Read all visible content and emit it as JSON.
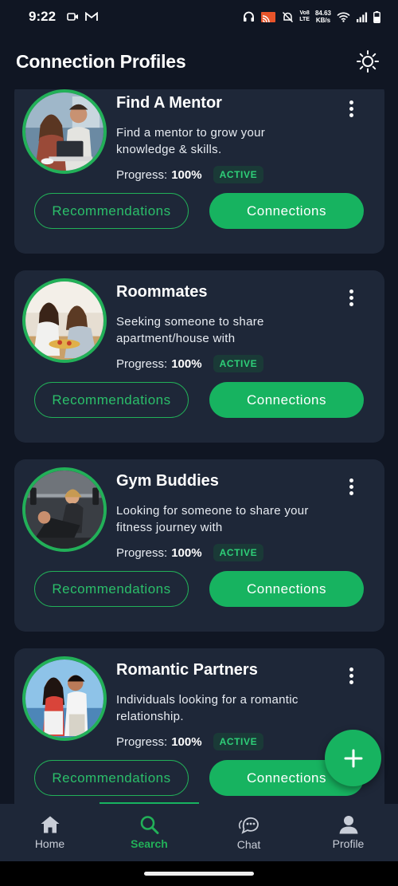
{
  "status_bar": {
    "time": "9:22",
    "network_label_top": "Vo8",
    "network_label_bottom": "LTE",
    "speed_top": "84.63",
    "speed_bottom": "KB/s"
  },
  "header": {
    "title": "Connection Profiles",
    "theme_icon": "sun-icon"
  },
  "colors": {
    "background": "#101623",
    "card": "#1e2738",
    "accent": "#17b360",
    "badge_bg": "#1a3a37"
  },
  "cards": [
    {
      "title": "Find A Mentor",
      "description": "Find a mentor to grow your knowledge & skills.",
      "progress_label": "Progress:",
      "progress_value": "100%",
      "status": "ACTIVE",
      "recommendations_label": "Recommendations",
      "connections_label": "Connections"
    },
    {
      "title": "Roommates",
      "description": "Seeking someone to share apartment/house with",
      "progress_label": "Progress:",
      "progress_value": "100%",
      "status": "ACTIVE",
      "recommendations_label": "Recommendations",
      "connections_label": "Connections"
    },
    {
      "title": "Gym Buddies",
      "description": "Looking for someone to share your fitness journey with",
      "progress_label": "Progress:",
      "progress_value": "100%",
      "status": "ACTIVE",
      "recommendations_label": "Recommendations",
      "connections_label": "Connections"
    },
    {
      "title": "Romantic Partners",
      "description": "Individuals looking for a romantic relationship.",
      "progress_label": "Progress:",
      "progress_value": "100%",
      "status": "ACTIVE",
      "recommendations_label": "Recommendations",
      "connections_label": "Connections"
    }
  ],
  "fab": {
    "icon": "plus-icon"
  },
  "bottom_nav": {
    "items": [
      {
        "label": "Home",
        "icon": "home-icon"
      },
      {
        "label": "Search",
        "icon": "search-icon"
      },
      {
        "label": "Chat",
        "icon": "chat-icon"
      },
      {
        "label": "Profile",
        "icon": "profile-icon"
      }
    ],
    "active_index": 1
  }
}
